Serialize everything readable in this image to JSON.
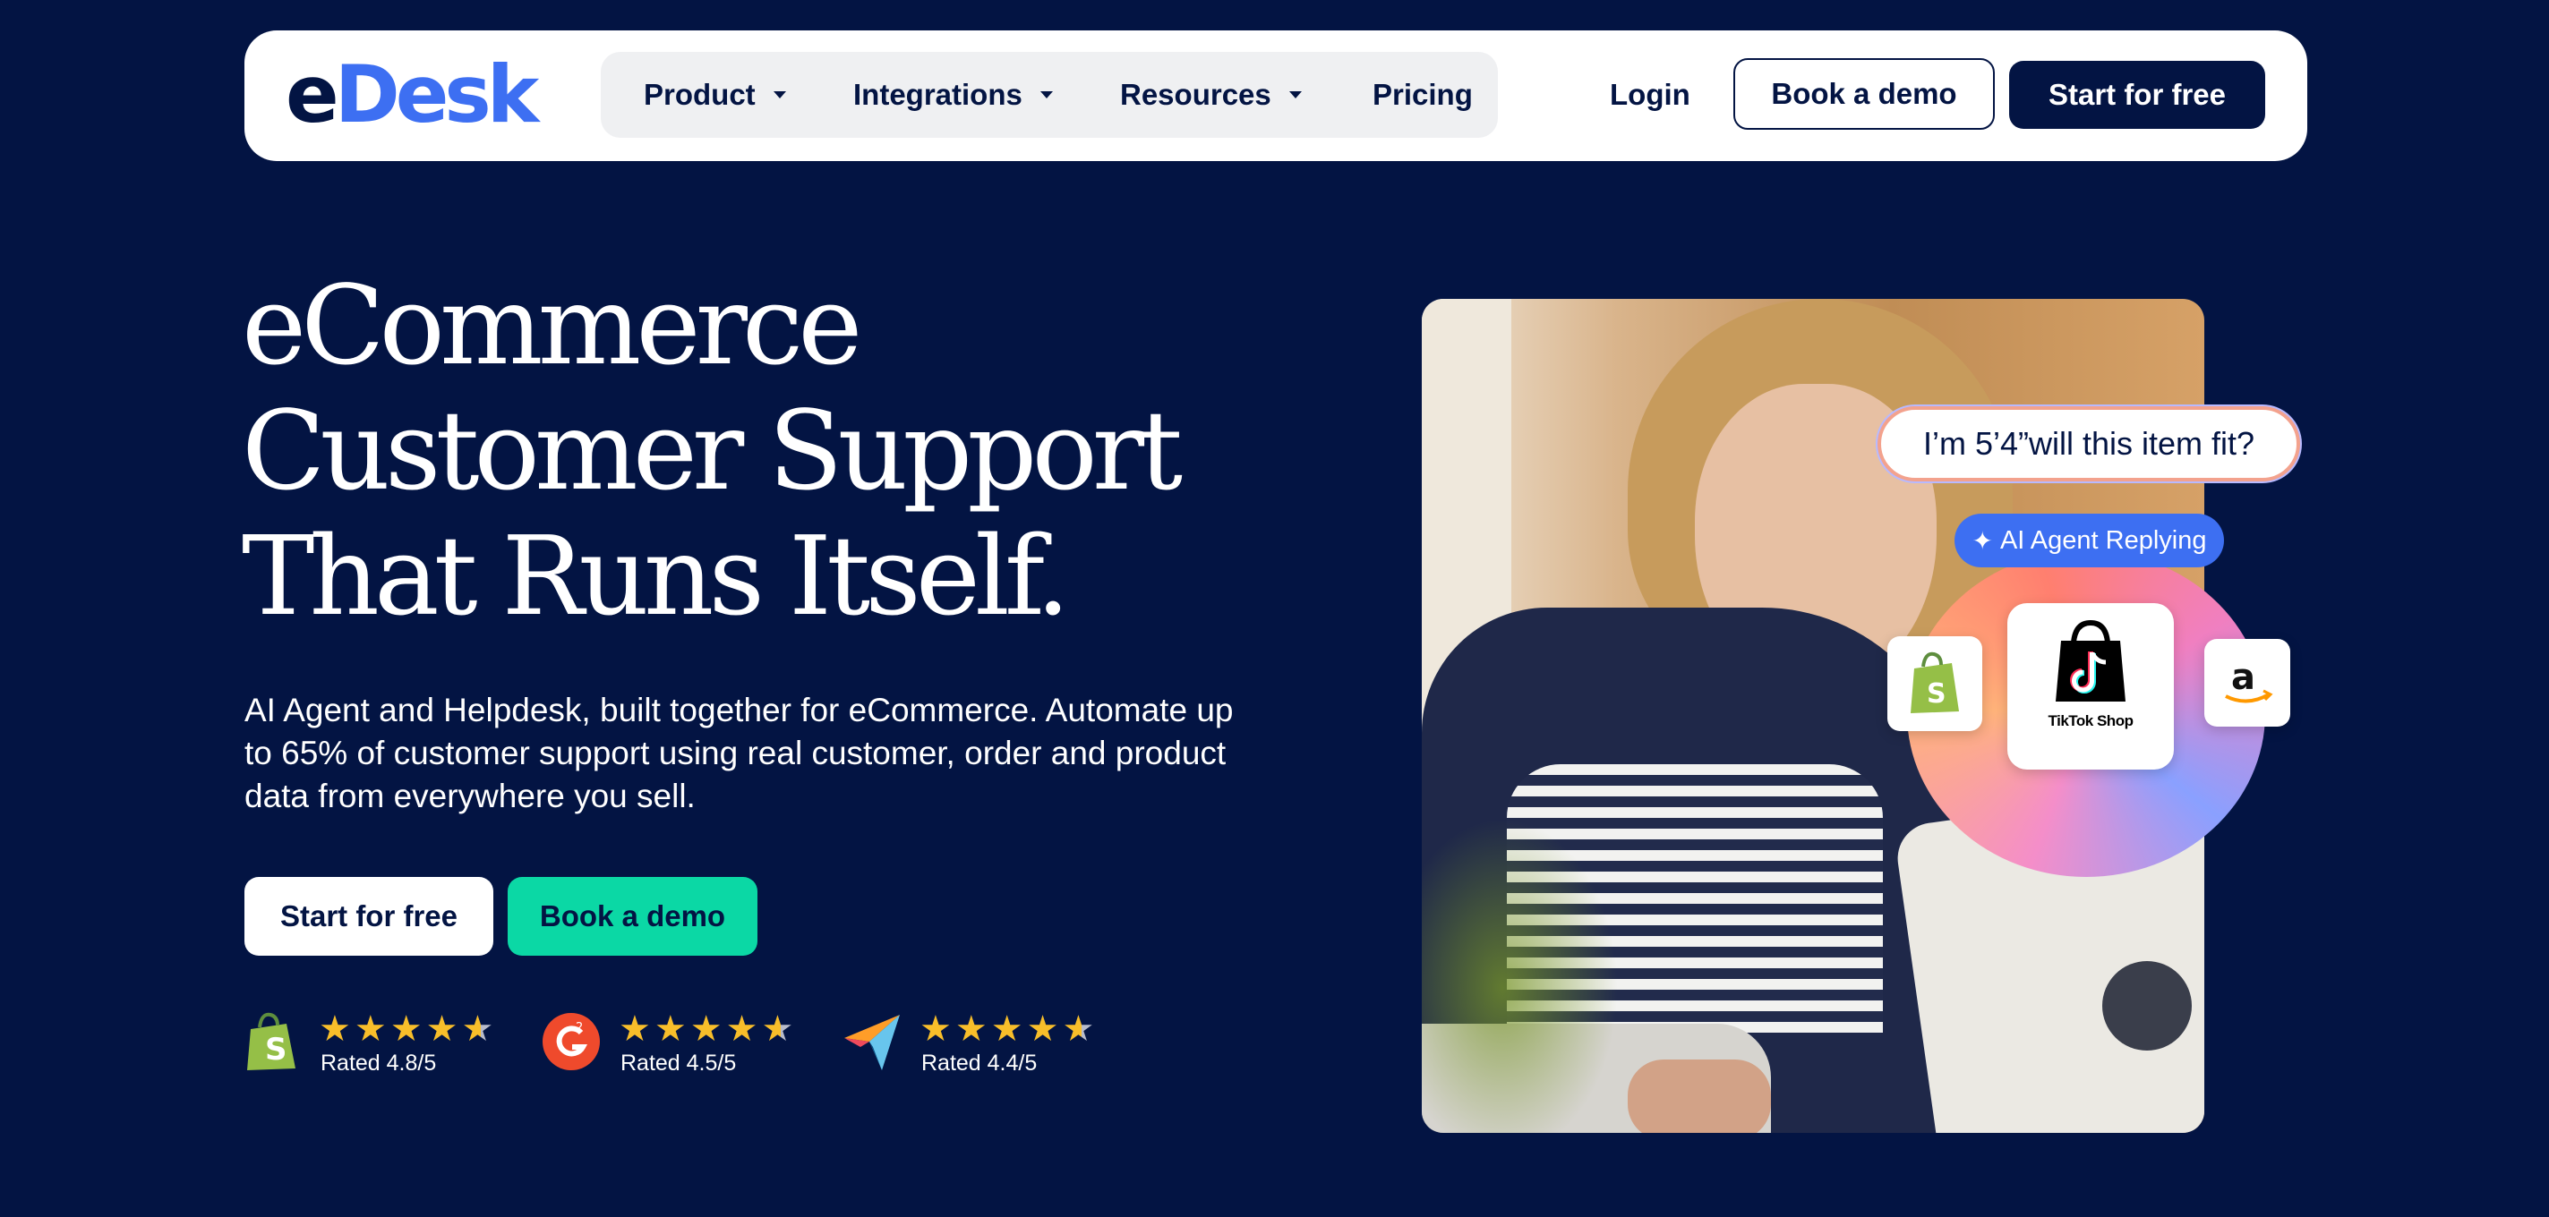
{
  "nav": {
    "logo_e": "e",
    "logo_desk": "Desk",
    "items": [
      {
        "label": "Product"
      },
      {
        "label": "Integrations"
      },
      {
        "label": "Resources"
      },
      {
        "label": "Pricing"
      }
    ],
    "login": "Login",
    "book_demo": "Book a demo",
    "start_free": "Start for free"
  },
  "hero": {
    "headline": [
      "eCommerce",
      "Customer Support",
      "That Runs Itself."
    ],
    "subtext": "AI Agent and Helpdesk, built together for eCommerce. Automate up to 65% of customer support using real customer, order and product data from everywhere you sell.",
    "cta_primary": "Start for free",
    "cta_secondary": "Book a demo"
  },
  "ratings": [
    {
      "platform_icon": "shopify-icon",
      "stars": 4.8,
      "label": "Rated 4.8/5"
    },
    {
      "platform_icon": "g2-icon",
      "stars": 4.5,
      "label": "Rated 4.5/5"
    },
    {
      "platform_icon": "capterra-icon",
      "stars": 4.4,
      "label": "Rated 4.4/5"
    }
  ],
  "visual": {
    "chat_bubble": "I’m 5’4”will this item fit?",
    "agent_status": "AI Agent Replying",
    "tiktok_label": "TikTok Shop",
    "marketplace_icons": [
      "shopify-icon",
      "tiktok-shop-icon",
      "amazon-icon"
    ]
  },
  "colors": {
    "background": "#031443",
    "brand_blue": "#3d6ff2",
    "cta_green": "#0bd8a5",
    "star_yellow": "#f8be2a"
  }
}
